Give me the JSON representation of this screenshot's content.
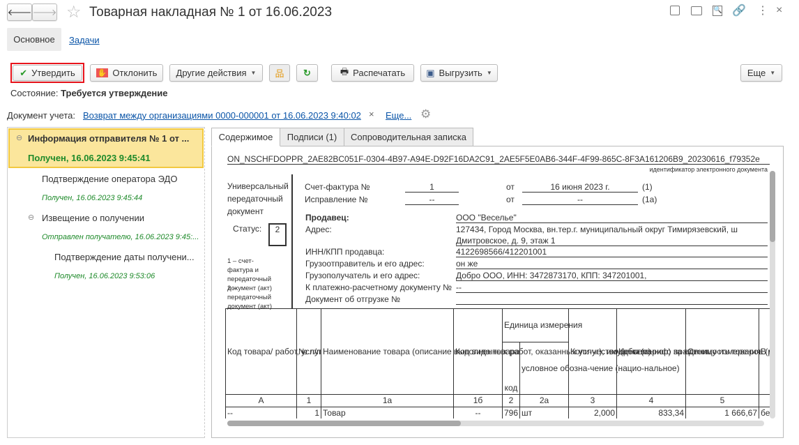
{
  "header": {
    "title": "Товарная накладная № 1 от 16.06.2023",
    "icons": [
      "arrow-left",
      "arrow-right",
      "star",
      "save",
      "print",
      "preview",
      "link",
      "more-vertical",
      "close"
    ]
  },
  "nav_tabs": [
    {
      "label": "Основное",
      "active": true
    },
    {
      "label": "Задачи"
    }
  ],
  "toolbar": {
    "approve": "Утвердить",
    "reject": "Отклонить",
    "other": "Другие действия",
    "print": "Распечатать",
    "export": "Выгрузить",
    "more": "Еще"
  },
  "status": {
    "label": "Состояние:",
    "value": "Требуется утверждение"
  },
  "account_doc": {
    "label": "Документ учета:",
    "link": "Возврат между организациями 0000-000001 от 16.06.2023 9:40:02",
    "clear": "×",
    "more": "Еще..."
  },
  "tree": [
    {
      "title": "Информация отправителя № 1 от ...",
      "status": "Получен, 16.06.2023 9:45:41"
    },
    {
      "title": "Подтверждение оператора ЭДО",
      "status": "Получен, 16.06.2023 9:45:44"
    },
    {
      "title": "Извещение о получении",
      "status": "Отправлен получателю, 16.06.2023 9:45:..."
    },
    {
      "title": "Подтверждение даты получени...",
      "status": "Получен, 16.06.2023 9:53:06"
    }
  ],
  "content_tabs": [
    {
      "label": "Содержимое",
      "active": true
    },
    {
      "label": "Подписи (1)"
    },
    {
      "label": "Сопроводительная записка"
    }
  ],
  "doc": {
    "id": "ON_NSCHFDOPPR_2AE82BC051F-0304-4B97-A94E-D92F16DA2C91_2AE5F5E0AB6-344F-4F99-865C-8F3A161206B9_20230616_f79352e",
    "id_caption": "идентификатор электронного документа",
    "upd": "Универсальный передаточный документ",
    "status_label": "Статус:",
    "status_value": "2",
    "status_note1": "1 – счет-фактура и передаточный документ (акт)",
    "status_note2": "2 – передаточный документ (акт)",
    "invoice_label": "Счет-фактура №",
    "invoice_no": "1",
    "from": "от",
    "invoice_date": "16 июня 2023 г.",
    "invoice_ref": "(1)",
    "fix_label": "Исправление №",
    "fix_no": "--",
    "fix_date": "--",
    "fix_ref": "(1а)",
    "rows": [
      {
        "label": "Продавец:",
        "value": "ООО \"Веселье\""
      },
      {
        "label": "Адрес:",
        "value": "127434, Город Москва, вн.тер.г. муниципальный округ Тимирязевский, ш",
        "value2": "Дмитровское, д. 9, этаж 1"
      },
      {
        "label": "ИНН/КПП продавца:",
        "value": "4122698566/412201001"
      },
      {
        "label": "Грузоотправитель и его адрес:",
        "value": "он же"
      },
      {
        "label": "Грузополучатель и его адрес:",
        "value": "Добро ООО, ИНН: 3472873170, КПП: 347201001,"
      },
      {
        "label": "К платежно-расчетному документу №",
        "value": "--"
      },
      {
        "label": "Документ об отгрузке №",
        "value": ""
      }
    ],
    "table": {
      "headers": [
        "Код товара/ работ, услуг",
        "№ п/п",
        "Наименование товара (описание выполненных работ, оказанных услуг), имущественного права",
        "Код вида товара",
        "Единица измерения",
        "код",
        "условное обозна-чение (нацио-нальное)",
        "Коли-чество (объем)",
        "Цена (тариф) за единицу измерения",
        "Стоимость товаров (работ, услуг), имущест-венных прав без налога - всего",
        "В ч с а"
      ],
      "codes": [
        "А",
        "1",
        "1а",
        "1б",
        "2",
        "2а",
        "3",
        "4",
        "5",
        ""
      ],
      "row": [
        "--",
        "1",
        "Товар",
        "--",
        "796",
        "шт",
        "2,000",
        "833,34",
        "1 666,67",
        "бе"
      ]
    }
  }
}
